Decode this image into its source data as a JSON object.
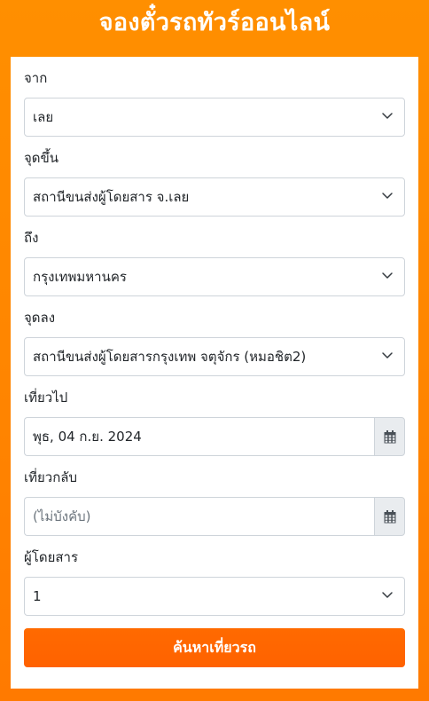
{
  "header": {
    "title": "จองตั๋วรถทัวร์ออนไลน์"
  },
  "form": {
    "from": {
      "label": "จาก",
      "value": "เลย"
    },
    "pickup": {
      "label": "จุดขึ้น",
      "value": "สถานีขนส่งผู้โดยสาร จ.เลย"
    },
    "to": {
      "label": "ถึง",
      "value": "กรุงเทพมหานคร"
    },
    "dropoff": {
      "label": "จุดลง",
      "value": "สถานีขนส่งผู้โดยสารกรุงเทพ จตุจักร (หมอชิต2)"
    },
    "depart": {
      "label": "เที่ยวไป",
      "value": "พุธ, 04 ก.ย. 2024"
    },
    "return": {
      "label": "เที่ยวกลับ",
      "placeholder": "(ไม่บังคับ)"
    },
    "passengers": {
      "label": "ผู้โดยสาร",
      "value": "1"
    },
    "submit_label": "ค้นหาเที่ยวรถ"
  },
  "icons": {
    "dropdown": "chevron-down-icon",
    "calendar": "calendar-icon"
  },
  "colors": {
    "background": "#ff8c00",
    "button": "#ff6600",
    "addon": "#e9ecef"
  }
}
